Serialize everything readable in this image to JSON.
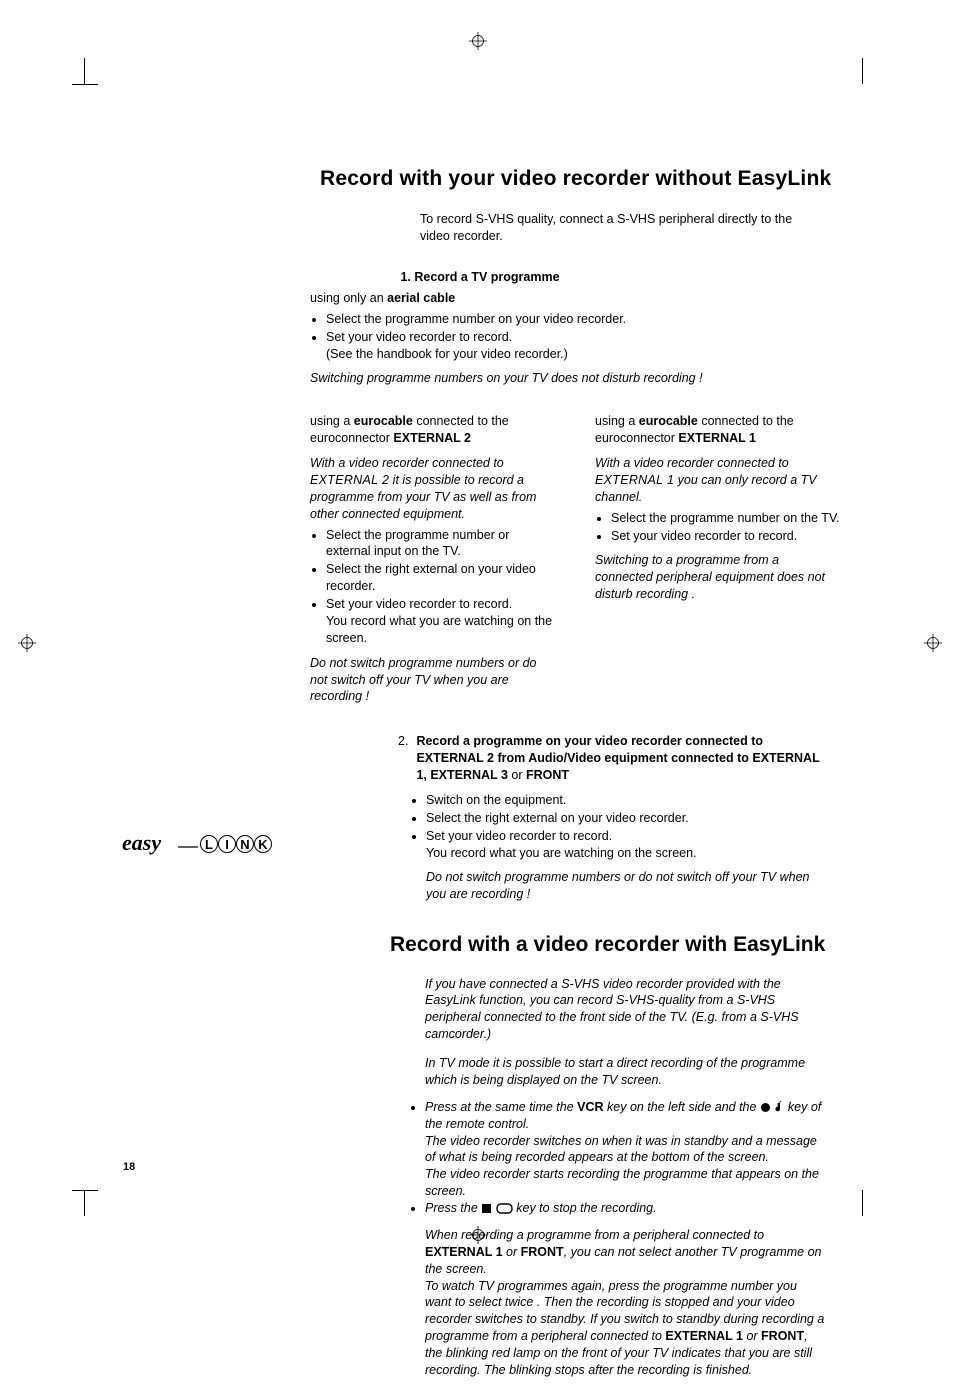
{
  "page_number": "18",
  "title1": "Record with your video recorder without EasyLink",
  "intro": "To record S-VHS quality, connect a S-VHS peripheral directly to the video recorder.",
  "sec1": {
    "heading": "1.   Record a TV programme",
    "aerial": {
      "prefix": "using only an ",
      "bold": "aerial cable",
      "items": [
        "Select the programme number on your video recorder.",
        "Set your video recorder to record."
      ],
      "sub": "(See the handbook for your video recorder.)",
      "note": "Switching programme numbers on your TV does not disturb recording !"
    },
    "left": {
      "line1_a": "using a ",
      "line1_b": "eurocable",
      "line1_c": " connected to the euroconnector ",
      "line1_d": "EXTERNAL 2",
      "note1_a": "With a video recorder connected to ",
      "note1_b": "EXTERNAL 2",
      "note1_c": " it is possible to record a programme from your TV as well as from other connected equipment.",
      "items": [
        "Select the programme number or external input on the TV.",
        "Select the right external on your video recorder.",
        "Set your video recorder to record."
      ],
      "sub": "You record what you are watching on the screen.",
      "note2": "Do not switch programme numbers or do not switch off your TV when you are  recording !"
    },
    "right": {
      "line1_a": "using a ",
      "line1_b": "eurocable",
      "line1_c": " connected to the euroconnector ",
      "line1_d": "EXTERNAL 1",
      "note1_a": "With a video recorder connected to ",
      "note1_b": "EXTERNAL 1",
      "note1_c": " you can only record a TV channel.",
      "items": [
        "Select the programme number on the TV.",
        "Set your video recorder to record."
      ],
      "note2": "Switching to a programme from a connected peripheral equipment does not disturb recording ."
    }
  },
  "sec2": {
    "num": "2.",
    "head_a": "Record a programme on your video recorder connected to ",
    "head_b": "EXTERNAL 2",
    "head_c": " from Audio/Video equipment connected to ",
    "head_d": "EXTERNAL 1",
    "head_e": ", ",
    "head_f": "EXTERNAL 3",
    "head_g": " or ",
    "head_h": "FRONT",
    "items": [
      "Switch on the equipment.",
      "Select the right external on your video recorder.",
      "Set your video recorder to record."
    ],
    "sub": "You record what you are watching on the screen.",
    "note": "Do not switch programme numbers or do not switch off your TV when you are recording !"
  },
  "title2": "Record with a video recorder with EasyLink",
  "sec3": {
    "intro": "If you have connected a S-VHS video recorder provided with the EasyLink function, you can record S-VHS-quality from a S-VHS peripheral connected to the front side of the TV.  (E.g. from a S-VHS camcorder.)",
    "p1": "In TV mode it is possible to start a direct recording of the programme which is being displayed on the TV screen.",
    "b1_a": "Press at the same time the ",
    "b1_b": "VCR",
    "b1_c": " key on the left side and the ",
    "b1_d": " key of the remote control.",
    "p2": "The video recorder switches on when it was in standby and a message of what is being recorded appears at the bottom of the screen.",
    "p3": "The video recorder starts recording the programme that appears on the screen.",
    "b2_a": "Press the ",
    "b2_b": " key to stop the recording.",
    "w_a": "When recording a programme from a peripheral connected to ",
    "w_b": "EXTERNAL 1",
    "w_c": " or ",
    "w_d": "FRONT",
    "w_e": ", you can not select another TV programme on the screen.",
    "w2": "To watch TV programmes again, press the programme number you want to select twice . Then the recording is stopped and your video recorder switches to standby. If you switch to standby during recording a programme from a peripheral connected to ",
    "w2_b": "EXTERNAL 1",
    "w2_c": " or ",
    "w2_d": "FRONT",
    "w2_e": ", the blinking red lamp on the front of your TV indicates that you are still recording. The blinking stops after the recording is finished."
  },
  "easylink_script": "easy",
  "easylink_caps": "L I N K"
}
